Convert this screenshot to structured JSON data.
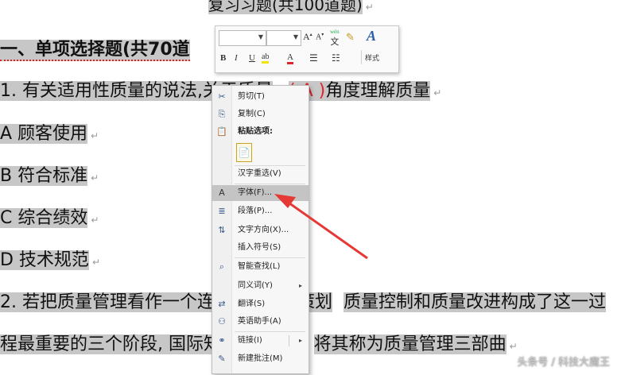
{
  "document": {
    "heading": "复习习题(共100道题)",
    "section_title": "一、单项选择题(共70道",
    "q1_prefix": "1. 有关适用性质量的说法,",
    "q1_hidden": "关于质量",
    "q1_answer": "( A )",
    "q1_suffix": "角度理解质量",
    "option_a": "A 顾客使用",
    "option_b": "B 符合标准",
    "option_c": "C 综合绩效",
    "option_d": "D 技术规范",
    "q2_prefix": "2. 若把质量管理看作一个连续",
    "q2_mid": "量策划",
    "q2_suffix": "质量控制和质量改进构成了这一过",
    "q3_prefix": "程最重要的三个阶段, 国际知名",
    "q3_answer": ")",
    "q3_suffix": "将其称为质量管理三部曲",
    "para_mark": "↵"
  },
  "mini_toolbar": {
    "font_name": "",
    "font_size": "",
    "grow_font": "A",
    "shrink_font": "A",
    "phonetic": "wén",
    "format_painter": "✎",
    "styles_icon": "A",
    "styles_label": "样式",
    "bold": "B",
    "italic": "I",
    "underline": "U",
    "highlight": "ab",
    "font_color": "A",
    "bullets": "☰",
    "numbering": "☷"
  },
  "context_menu": {
    "items": [
      {
        "icon": "✂",
        "label": "剪切(T)"
      },
      {
        "icon": "⎘",
        "label": "复制(C)"
      },
      {
        "icon": "📋",
        "label": "粘贴选项:"
      },
      {
        "icon": "",
        "label": "汉字重选(V)"
      },
      {
        "icon": "A",
        "label": "字体(F)..."
      },
      {
        "icon": "≣",
        "label": "段落(P)..."
      },
      {
        "icon": "⇅",
        "label": "文字方向(X)..."
      },
      {
        "icon": "",
        "label": "插入符号(S)"
      },
      {
        "icon": "⌕",
        "label": "智能查找(L)"
      },
      {
        "icon": "",
        "label": "同义词(Y)",
        "sub": "▸"
      },
      {
        "icon": "⇄",
        "label": "翻译(S)"
      },
      {
        "icon": "⚇",
        "label": "英语助手(A)"
      },
      {
        "icon": "⚭",
        "label": "链接(I)",
        "sub": "▸"
      },
      {
        "icon": "✎",
        "label": "新建批注(M)"
      }
    ]
  },
  "watermark": "头条号 / 科技大魔王",
  "colors": {
    "highlight": "#c7c7c7",
    "answer_red": "#e0242b",
    "arrow_red": "#e53935",
    "menu_active": "#c4c4c4"
  }
}
